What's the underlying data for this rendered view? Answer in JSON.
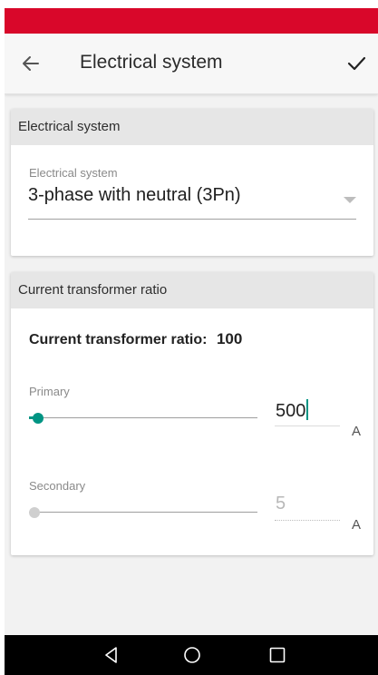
{
  "colors": {
    "status_bar": "#d9072a",
    "accent": "#009483",
    "nav_bar": "#000000"
  },
  "app_bar": {
    "title": "Electrical system",
    "back_icon": "back-arrow-icon",
    "confirm_icon": "checkmark-icon"
  },
  "electrical_card": {
    "header": "Electrical system",
    "field_label": "Electrical system",
    "selected_value": "3-phase with neutral (3Pn)",
    "dropdown_icon": "dropdown-triangle-icon"
  },
  "ct_card": {
    "header": "Current transformer ratio",
    "ratio_label": "Current transformer ratio:",
    "ratio_value": "100",
    "primary": {
      "label": "Primary",
      "value": "500",
      "unit": "A",
      "slider_fraction": 0.04
    },
    "secondary": {
      "label": "Secondary",
      "value": "5",
      "unit": "A",
      "slider_fraction": 0.0
    }
  },
  "nav_bar": {
    "icons": [
      "back-triangle-icon",
      "home-circle-icon",
      "recents-square-icon"
    ]
  }
}
